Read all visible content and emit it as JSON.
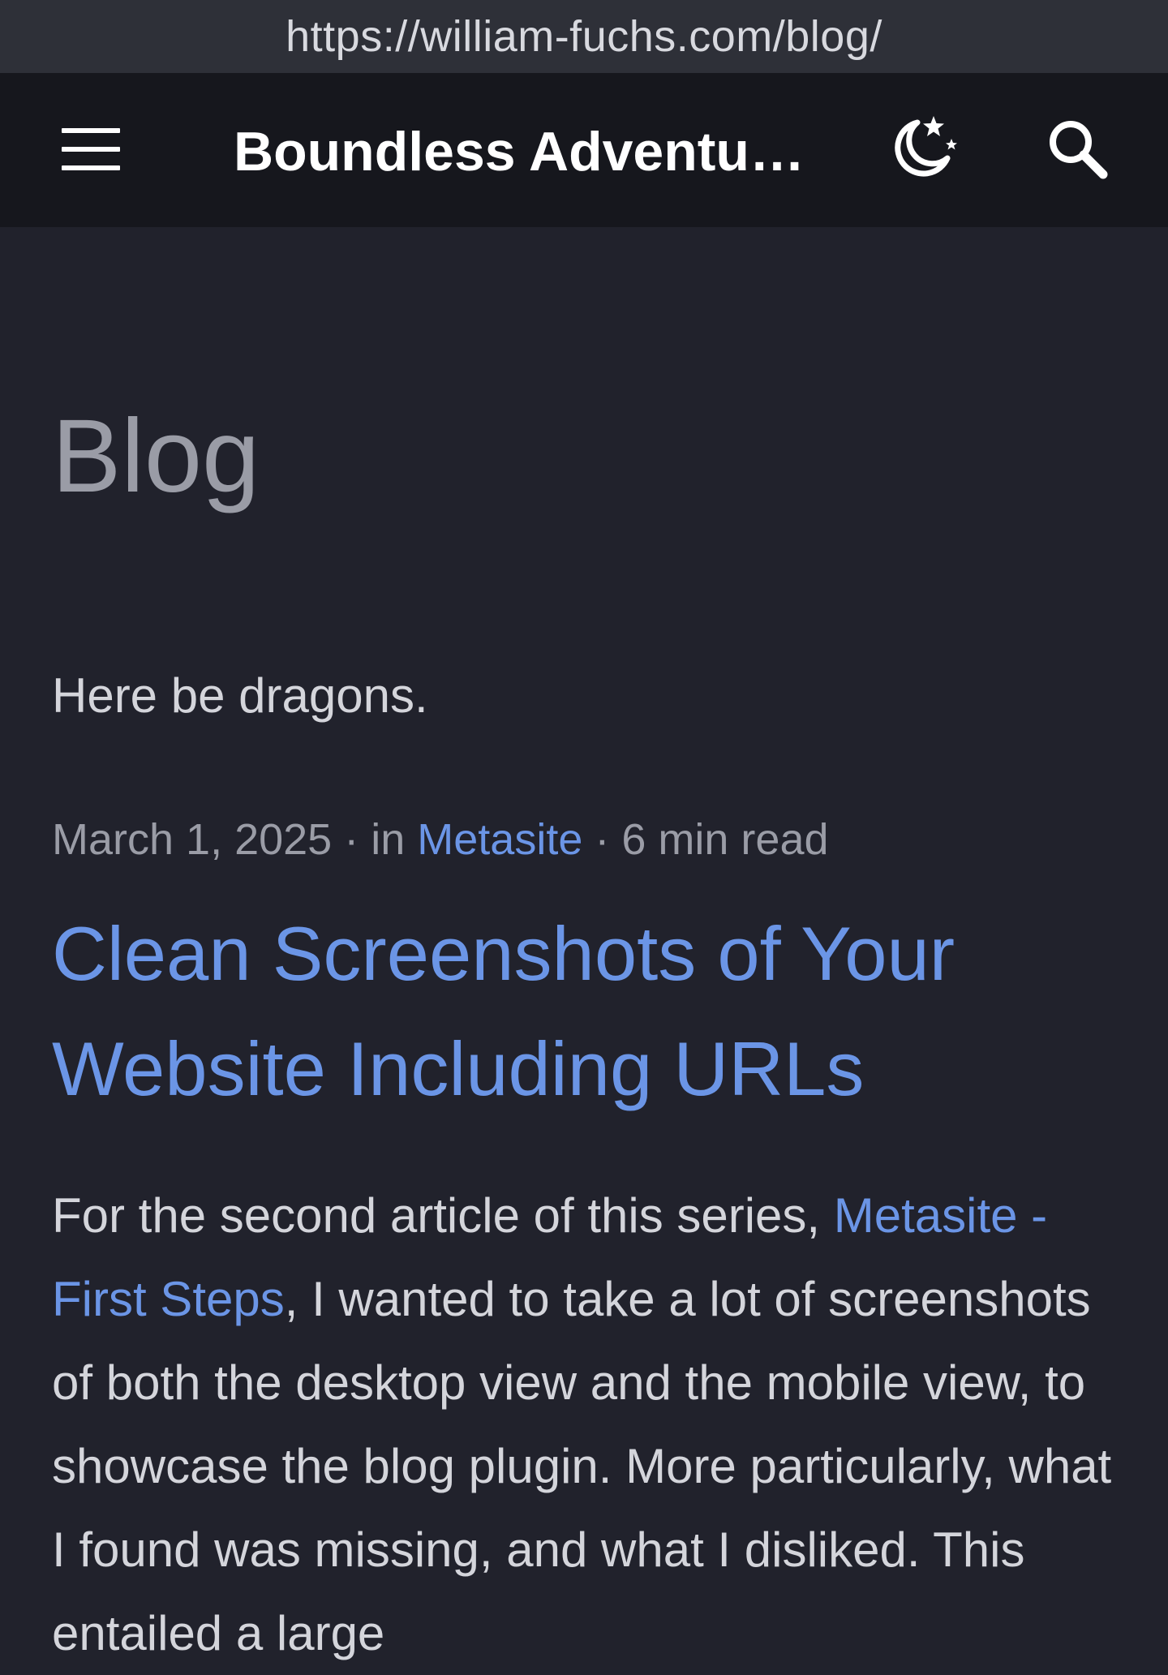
{
  "browser": {
    "url": "https://william-fuchs.com/blog/"
  },
  "header": {
    "site_title": "Boundless Adventures",
    "menu_icon": "hamburger-menu-icon",
    "theme_icon": "moon-stars-icon",
    "search_icon": "search-icon"
  },
  "main": {
    "page_title": "Blog",
    "tagline": "Here be dragons.",
    "post": {
      "date": "March 1, 2025",
      "category_prefix": "in",
      "category": "Metasite",
      "separator": "·",
      "read_time": "6 min read",
      "title": "Clean Screenshots of Your Website Including URLs",
      "excerpt_before": "For the second article of this series, ",
      "excerpt_link": "Metasite - First Steps",
      "excerpt_after": ", I wanted to take a lot of screenshots of both the desktop view and the mobile view, to showcase the blog plugin. More particularly, what I found was missing, and what I disliked. This entailed a large"
    }
  },
  "colors": {
    "background": "#21222c",
    "header_background": "#16171d",
    "url_bar_background": "#2e3038",
    "accent": "#6b95e6",
    "muted_text": "#9a9ca6",
    "body_text": "#d4d5db"
  }
}
